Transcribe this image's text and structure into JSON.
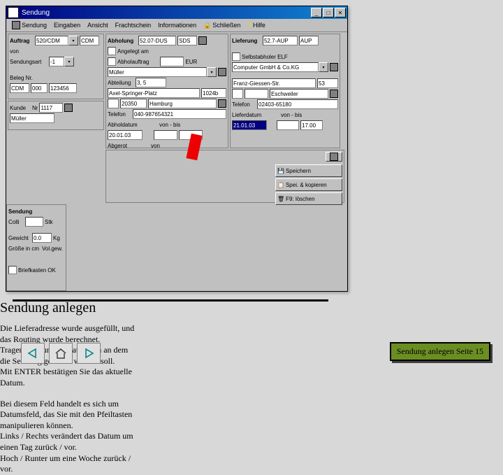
{
  "help": {
    "title": "Sendung anlegen",
    "p1": "Die Lieferadresse wurde ausgefüllt, und das Routing wurde berechnet.\nTragen Sie nun das Datum ein an dem die Sendung geliefert werden soll.\nMit ENTER bestätigen Sie das aktuelle Datum.",
    "p2": "Bei diesem Feld handelt es sich um Datumsfeld, das Sie mit den Pfeiltasten manipulieren können.\nLinks / Rechts verändert das Datum um einen Tag zurück / vor.\nHoch / Runter um eine Woche zurück / vor."
  },
  "footer": "Sendung anlegen Seite 15",
  "win": {
    "title": "Sendung"
  },
  "menu": {
    "sendung": "Sendung",
    "eingaben": "Eingaben",
    "ansicht": "Ansicht",
    "frachtschein": "Frachtschein",
    "informationen": "Informationen",
    "schliessen": "Schließen",
    "hilfe": "Hilfe"
  },
  "auftrag": {
    "label": "Auftrag",
    "von": "von",
    "val1": "520/CDM",
    "val2": "CDM",
    "sendungsart": "Sendungsart",
    "sart_val": "-1",
    "beleg": "Beleg Nr.",
    "b1": "CDM",
    "b2": "000",
    "b3": "123456",
    "kunde": "Kunde",
    "nr": "Nr",
    "nr_val": "1117",
    "name": "Müller"
  },
  "abholung": {
    "label": "Abholung",
    "code": "52.07-DUS",
    "sds": "SDS",
    "angelegt": "Angelegt am",
    "abholauftrag": "Abholauftrag",
    "eur": "EUR",
    "name": "Müller",
    "abt": "Abteilung",
    "abt_val": "3, 5",
    "str": "Axel-Springer-Platz",
    "hnr": "1024b",
    "plz": "20350",
    "ort": "Hamburg",
    "tel": "Telefon",
    "tel_val": "040-987654321",
    "abhdatum": "Abholdatum",
    "abhdatum_val": "20.01.03",
    "vonbis": "von - bis",
    "abgerot": "Abgerot",
    "von": "von"
  },
  "lieferung": {
    "label": "Lieferung",
    "code": "52.7-AUP",
    "aup": "AUP",
    "selbst": "Selbstabholer ELF",
    "name": "Computer GmbH & Co.KG",
    "str": "Franz-Giessen-Str.",
    "hnr": "53",
    "plz_label": "",
    "plz": "",
    "ort": "Eschweiler",
    "tel": "Telefon",
    "tel_val": "02403-65180",
    "liefdatum": "Lieferdatum",
    "liefdatum_val": "21.01.03",
    "vonbis": "von - bis",
    "bis_val": "17.00"
  },
  "sendung": {
    "label": "Sendung",
    "colli": "Colli",
    "stk": "Stk",
    "gewicht": "Gewicht",
    "gew_val": "0.0",
    "kg": "Kg",
    "groesse": "Größe in cm",
    "volgew": "Vol.gew.",
    "briefkasten": "Briefkasten OK"
  },
  "sidebtns": {
    "speichern": "Speichern",
    "kopieren": "Spei. & kopieren",
    "loeschen": "F9: löschen"
  }
}
